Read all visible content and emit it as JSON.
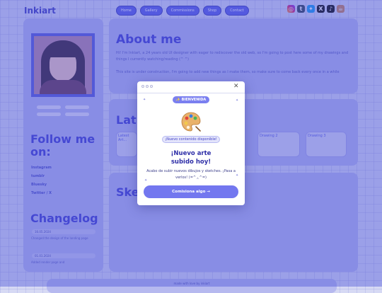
{
  "header": {
    "brand": "Inkiart",
    "nav": [
      "Home",
      "Gallery",
      "Commissions",
      "Shop",
      "Contact"
    ],
    "social_icons": [
      "instagram-icon",
      "tumblr-icon",
      "twitter-bird-icon",
      "x-icon",
      "tiktok-icon",
      "ko-fi-icon"
    ]
  },
  "sidebar": {
    "follow_heading": "Follow me on:",
    "links": [
      "Instagram",
      "tumblr",
      "Bluesky",
      "Twitter / X"
    ],
    "changelog_heading": "Changelog",
    "changelog": [
      {
        "date": "16.05.2024",
        "text": "Changed the design of the landing page"
      },
      {
        "date": "01.01.2024",
        "text": "Added render page and"
      }
    ]
  },
  "main": {
    "about_heading": "About me",
    "about_p1": "Hi! I'm Inkiart, a 24 years old UI designer with eager to rediscover the old web, so I'm going to post here some of my drawings and things I currently watching/reading (^ ^)",
    "about_p2": "This site is under construction, I'm going to add new things as I make them, so make sure to come back every once in a while",
    "latest_heading": "Lat",
    "thumbs": [
      "Latest Art...",
      "Drawing 2",
      "Drawing 3"
    ],
    "sketch_heading": "Ske",
    "footer_text": "made with love by inkiart"
  },
  "modal": {
    "badge": "✨ BIENVENIDA",
    "notice": "¡Nuevo contenido disponible!",
    "title_line1": "¡Nuevo arte",
    "title_line2": "subido hoy!",
    "body": "Acabo de subir nuevos dibujos y sketches. ¡Pasa a verlos! (=^ᆺ^=)",
    "cta": "Comisiona algo →",
    "icon": "palette-icon"
  },
  "colors": {
    "accent": "#7377ef",
    "brand": "#3e3fbf",
    "overlay": "#4b50d7"
  }
}
